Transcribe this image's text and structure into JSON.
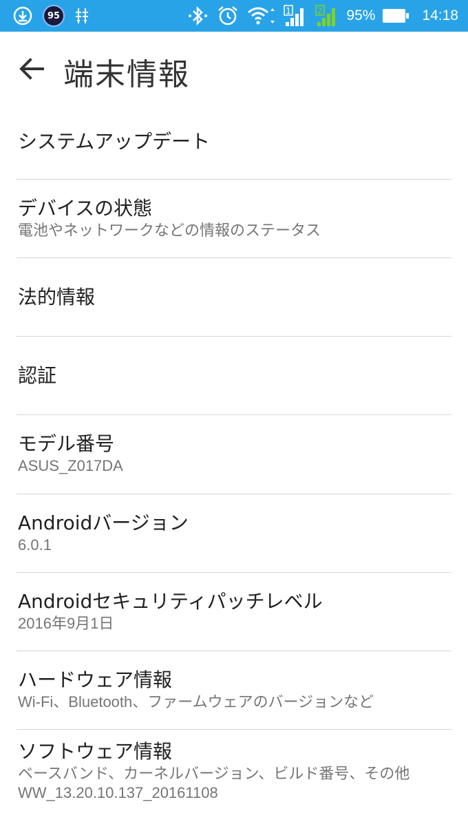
{
  "status_bar": {
    "notification_badge": "95",
    "battery_percent": "95%",
    "time": "14:18",
    "sim1_label": "1",
    "sim2_label": "2",
    "icons": [
      "download-icon",
      "usb-debug-icon",
      "bluetooth-icon",
      "alarm-icon",
      "wifi-icon",
      "signal-icon",
      "battery-icon"
    ]
  },
  "header": {
    "title": "端末情報"
  },
  "items": [
    {
      "title": "システムアップデート",
      "summary": ""
    },
    {
      "title": "デバイスの状態",
      "summary": "電池やネットワークなどの情報のステータス"
    },
    {
      "title": "法的情報",
      "summary": ""
    },
    {
      "title": "認証",
      "summary": ""
    },
    {
      "title": "モデル番号",
      "summary": "ASUS_Z017DA"
    },
    {
      "title": "Androidバージョン",
      "summary": "6.0.1"
    },
    {
      "title": "Androidセキュリティパッチレベル",
      "summary": "2016年9月1日"
    },
    {
      "title": "ハードウェア情報",
      "summary": "Wi-Fi、Bluetooth、ファームウェアのバージョンなど"
    },
    {
      "title": "ソフトウェア情報",
      "summary": "ベースバンド、カーネルバージョン、ビルド番号、その他",
      "summary2": "WW_13.20.10.137_20161108"
    }
  ],
  "colors": {
    "status_bar": "#29a3e8",
    "divider": "#d6d6d6",
    "summary_text": "#757575",
    "signal_green": "#7ed321"
  }
}
